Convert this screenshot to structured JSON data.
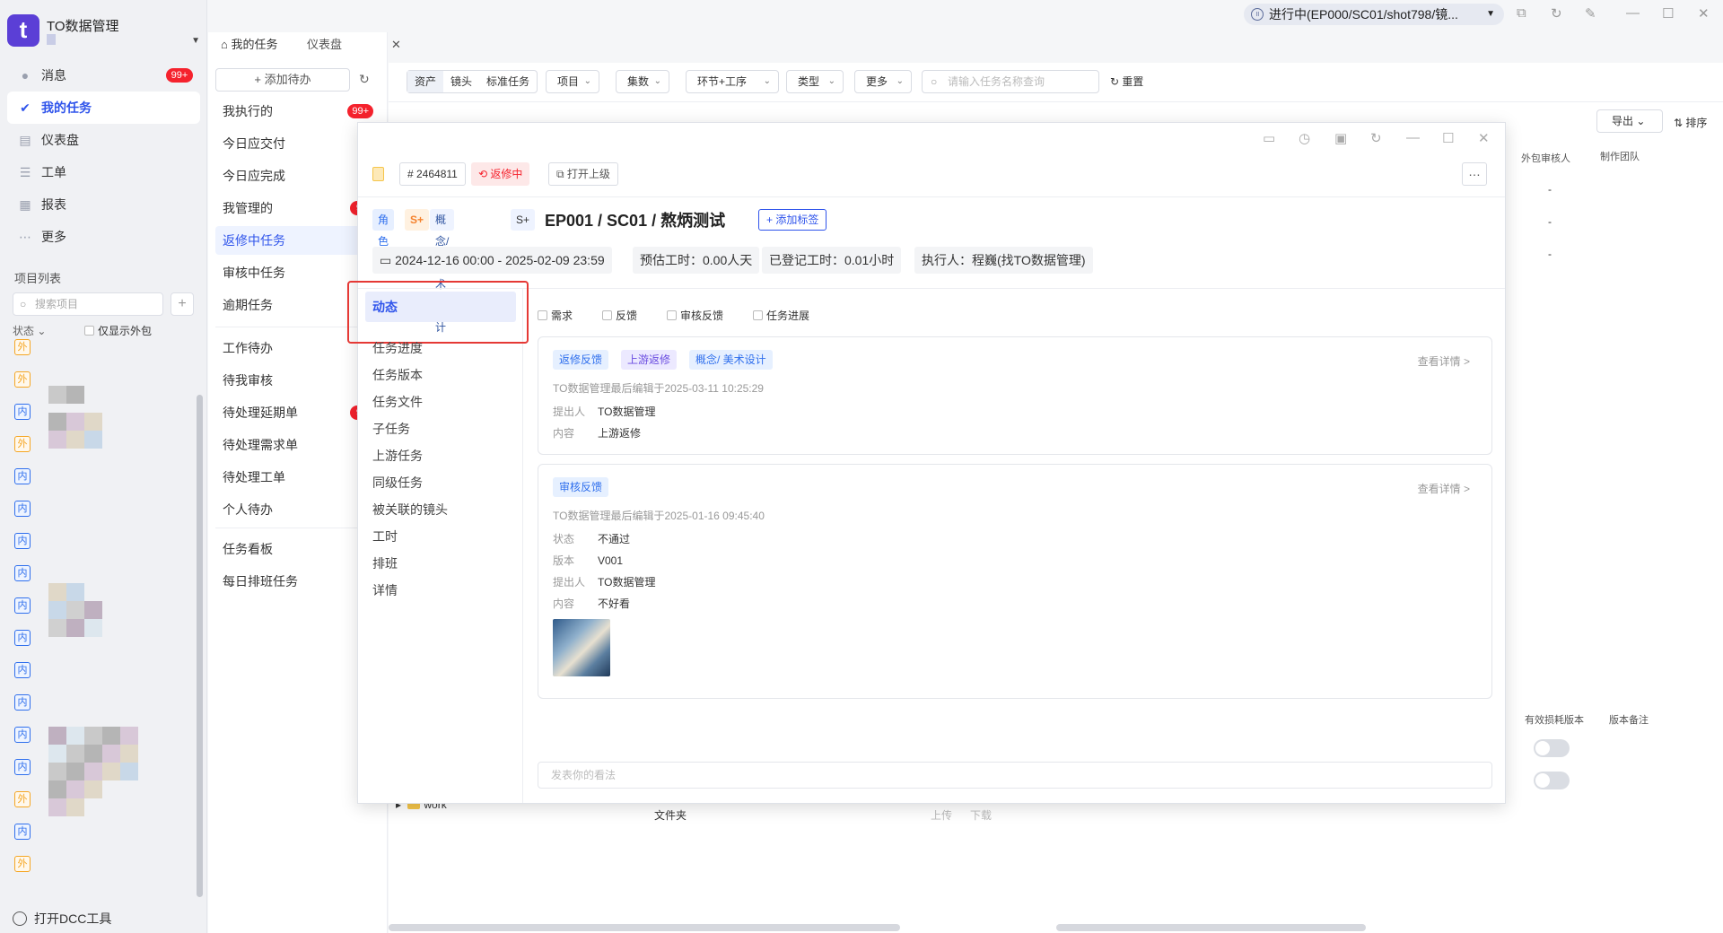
{
  "app": {
    "name": "TO数据管理"
  },
  "sidebar": {
    "items": [
      {
        "label": "消息",
        "icon": "message-icon",
        "badge": "99+"
      },
      {
        "label": "我的任务",
        "icon": "check-icon",
        "active": true
      },
      {
        "label": "仪表盘",
        "icon": "dashboard-icon"
      },
      {
        "label": "工单",
        "icon": "ticket-icon"
      },
      {
        "label": "报表",
        "icon": "report-icon"
      },
      {
        "label": "更多",
        "icon": "more-icon"
      }
    ],
    "project_list_title": "项目列表",
    "project_search_placeholder": "搜索项目",
    "status_filter": "状态",
    "only_external": "仅显示外包",
    "project_tags": [
      "外",
      "外",
      "内",
      "外",
      "内",
      "内",
      "内",
      "内",
      "内",
      "内",
      "内",
      "内",
      "内",
      "内",
      "外",
      "内",
      "外"
    ],
    "dcc_tool": "打开DCC工具"
  },
  "task_nav": {
    "tabs": [
      "我的任务",
      "仪表盘"
    ],
    "add_todo": "+ 添加待办",
    "groups": [
      [
        {
          "label": "我执行的",
          "badge": "99+"
        },
        {
          "label": "今日应交付"
        },
        {
          "label": "今日应完成"
        },
        {
          "label": "我管理的",
          "badge": "99"
        },
        {
          "label": "返修中任务",
          "active": true
        },
        {
          "label": "审核中任务"
        },
        {
          "label": "逾期任务",
          "badge": ""
        }
      ],
      [
        {
          "label": "工作待办"
        },
        {
          "label": "待我审核"
        },
        {
          "label": "待处理延期单",
          "badge": "99"
        },
        {
          "label": "待处理需求单"
        },
        {
          "label": "待处理工单",
          "badge": ""
        },
        {
          "label": "个人待办"
        }
      ],
      [
        {
          "label": "任务看板"
        },
        {
          "label": "每日排班任务"
        }
      ]
    ]
  },
  "topbar": {
    "status": "进行中(EP000/SC01/shot798/镜..."
  },
  "main": {
    "segments": [
      "资产",
      "镜头",
      "标准任务"
    ],
    "dropdowns": [
      "项目",
      "集数",
      "环节+工序",
      "类型",
      "更多"
    ],
    "search_placeholder": "请输入任务名称查询",
    "reset": "重置",
    "export": "导出",
    "sort": "排序",
    "columns_top": [
      "外包审核人",
      "制作团队"
    ],
    "columns_bottom": [
      "有效损耗版本",
      "版本备注"
    ],
    "dash": "-",
    "file_row": {
      "name": "work",
      "type": "文件夹",
      "upload": "上传",
      "download": "下载"
    }
  },
  "modal": {
    "task_id": "# 2464811",
    "status": "返修中",
    "open_parent": "打开上级",
    "chips": [
      "角色",
      "S+",
      "概念/美术设计",
      "S+"
    ],
    "title": "EP001 / SC01 / 熬炳测试",
    "add_tag": "+ 添加标签",
    "info": [
      "2024-12-16 00:00 - 2025-02-09 23:59",
      "预估工时：0.00人天",
      "已登记工时：0.01小时",
      "执行人：程巍(找TO数据管理)"
    ],
    "side_menu": [
      "动态",
      "任务进度",
      "任务版本",
      "任务文件",
      "子任务",
      "上游任务",
      "同级任务",
      "被关联的镜头",
      "工时",
      "排班",
      "详情"
    ],
    "filters": [
      "需求",
      "反馈",
      "审核反馈",
      "任务进展"
    ],
    "cards": [
      {
        "tags": [
          "返修反馈",
          "上游返修",
          "概念/ 美术设计"
        ],
        "detail": "查看详情 >",
        "meta": "TO数据管理最后编辑于2025-03-11 10:25:29",
        "fields": [
          {
            "k": "提出人",
            "v": "TO数据管理"
          },
          {
            "k": "内容",
            "v": "上游返修"
          }
        ]
      },
      {
        "tags": [
          "审核反馈"
        ],
        "detail": "查看详情 >",
        "meta": "TO数据管理最后编辑于2025-01-16 09:45:40",
        "fields": [
          {
            "k": "状态",
            "v": "不通过"
          },
          {
            "k": "版本",
            "v": "V001"
          },
          {
            "k": "提出人",
            "v": "TO数据管理"
          },
          {
            "k": "内容",
            "v": "不好看"
          }
        ]
      }
    ],
    "comment_placeholder": "发表你的看法"
  },
  "colors": {
    "accent": "#2f54eb",
    "danger": "#f5222d",
    "highlight": "#e53935"
  }
}
